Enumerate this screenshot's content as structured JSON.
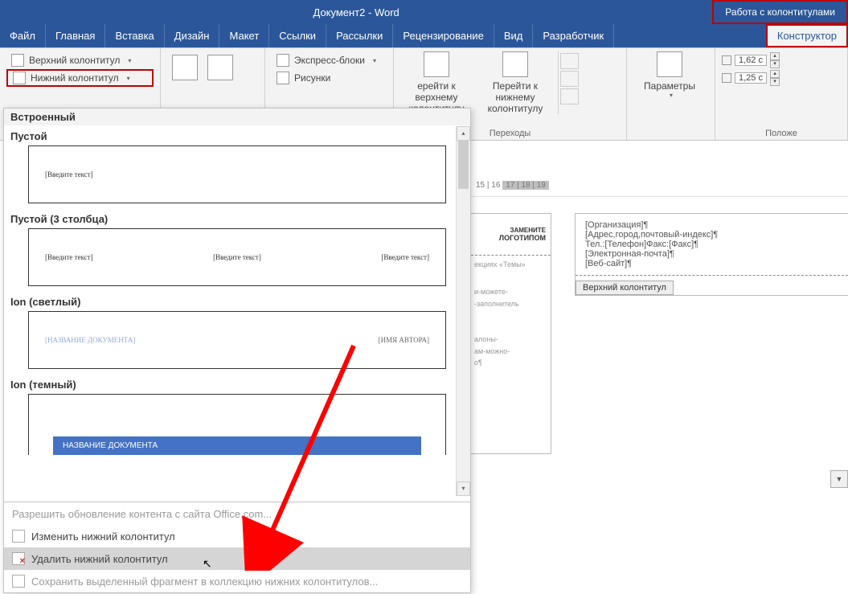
{
  "title": "Документ2 - Word",
  "context_tool_group": "Работа с колонтитулами",
  "tabs": {
    "file": "Файл",
    "home": "Главная",
    "insert": "Вставка",
    "design": "Дизайн",
    "layout": "Макет",
    "references": "Ссылки",
    "mailings": "Рассылки",
    "review": "Рецензирование",
    "view": "Вид",
    "developer": "Разработчик",
    "constructor": "Конструктор"
  },
  "ribbon": {
    "header_footer": {
      "header": "Верхний колонтитул",
      "footer": "Нижний колонтитул"
    },
    "insert_group": {
      "quick_parts": "Экспресс-блоки",
      "pictures": "Рисунки"
    },
    "navigation": {
      "goto_header": "ерейти к верхнему колонтитулу",
      "goto_footer": "Перейти к нижнему колонтитулу",
      "group_label": "Переходы"
    },
    "options": {
      "label": "Параметры"
    },
    "position": {
      "top": "1,62 с",
      "bottom": "1,25 с",
      "group_label": "Положе"
    }
  },
  "gallery": {
    "section_builtin": "Встроенный",
    "items": {
      "empty": {
        "title": "Пустой",
        "placeholder": "[Введите текст]"
      },
      "empty3": {
        "title": "Пустой (3 столбца)",
        "p1": "[Введите текст]",
        "p2": "[Введите текст]",
        "p3": "[Введите текст]"
      },
      "ion_light": {
        "title": "Ion (светлый)",
        "left": "[НАЗВАНИЕ ДОКУМЕНТА]",
        "right": "[ИМЯ АВТОРА]"
      },
      "ion_dark": {
        "title": "Ion (темный)",
        "band": "НАЗВАНИЕ ДОКУМЕНТА"
      }
    },
    "menu": {
      "office_update": "Разрешить обновление контента с сайта Office.com...",
      "edit": "Изменить нижний колонтитул",
      "remove": "Удалить нижний колонтитул",
      "save_sel": "Сохранить выделенный фрагмент в коллекцию нижних колонтитулов..."
    }
  },
  "ruler_text": "15 | 16",
  "ruler_text_dark": "17 | 18 | 19",
  "doc_header_right": {
    "l1": "[Организация]¶",
    "l2": "[Адрес,город,почтовый-индекс]¶",
    "l3": "Тел.:[Телефон]Факс:[Факс]¶",
    "l4": "[Электронная-почта]¶",
    "l5": "[Веб-сайт]¶",
    "tag": "Верхний колонтитул"
  },
  "doc_left": {
    "logo": "ЛОГОТИПОМ",
    "frag1": "екциях «Темы»",
    "frag2": "и-можете-",
    "frag3": "-заполнитель",
    "frag4": "алоны-",
    "frag5": "ам-можно-",
    "frag6": "о¶"
  }
}
